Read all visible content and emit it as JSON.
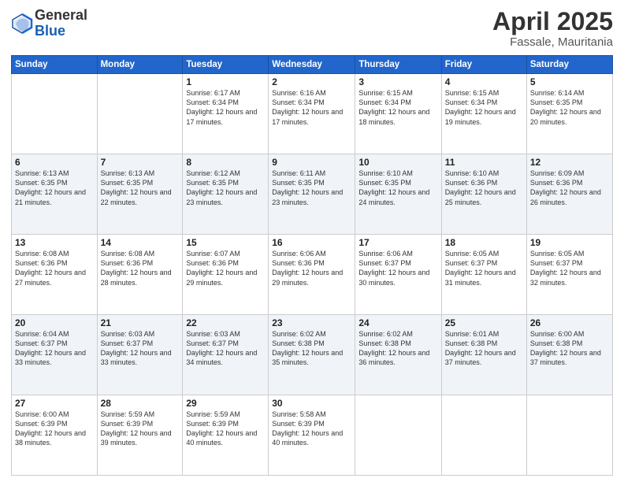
{
  "header": {
    "logo_general": "General",
    "logo_blue": "Blue",
    "month_title": "April 2025",
    "location": "Fassale, Mauritania"
  },
  "weekdays": [
    "Sunday",
    "Monday",
    "Tuesday",
    "Wednesday",
    "Thursday",
    "Friday",
    "Saturday"
  ],
  "weeks": [
    [
      {
        "day": "",
        "sunrise": "",
        "sunset": "",
        "daylight": ""
      },
      {
        "day": "",
        "sunrise": "",
        "sunset": "",
        "daylight": ""
      },
      {
        "day": "1",
        "sunrise": "Sunrise: 6:17 AM",
        "sunset": "Sunset: 6:34 PM",
        "daylight": "Daylight: 12 hours and 17 minutes."
      },
      {
        "day": "2",
        "sunrise": "Sunrise: 6:16 AM",
        "sunset": "Sunset: 6:34 PM",
        "daylight": "Daylight: 12 hours and 17 minutes."
      },
      {
        "day": "3",
        "sunrise": "Sunrise: 6:15 AM",
        "sunset": "Sunset: 6:34 PM",
        "daylight": "Daylight: 12 hours and 18 minutes."
      },
      {
        "day": "4",
        "sunrise": "Sunrise: 6:15 AM",
        "sunset": "Sunset: 6:34 PM",
        "daylight": "Daylight: 12 hours and 19 minutes."
      },
      {
        "day": "5",
        "sunrise": "Sunrise: 6:14 AM",
        "sunset": "Sunset: 6:35 PM",
        "daylight": "Daylight: 12 hours and 20 minutes."
      }
    ],
    [
      {
        "day": "6",
        "sunrise": "Sunrise: 6:13 AM",
        "sunset": "Sunset: 6:35 PM",
        "daylight": "Daylight: 12 hours and 21 minutes."
      },
      {
        "day": "7",
        "sunrise": "Sunrise: 6:13 AM",
        "sunset": "Sunset: 6:35 PM",
        "daylight": "Daylight: 12 hours and 22 minutes."
      },
      {
        "day": "8",
        "sunrise": "Sunrise: 6:12 AM",
        "sunset": "Sunset: 6:35 PM",
        "daylight": "Daylight: 12 hours and 23 minutes."
      },
      {
        "day": "9",
        "sunrise": "Sunrise: 6:11 AM",
        "sunset": "Sunset: 6:35 PM",
        "daylight": "Daylight: 12 hours and 23 minutes."
      },
      {
        "day": "10",
        "sunrise": "Sunrise: 6:10 AM",
        "sunset": "Sunset: 6:35 PM",
        "daylight": "Daylight: 12 hours and 24 minutes."
      },
      {
        "day": "11",
        "sunrise": "Sunrise: 6:10 AM",
        "sunset": "Sunset: 6:36 PM",
        "daylight": "Daylight: 12 hours and 25 minutes."
      },
      {
        "day": "12",
        "sunrise": "Sunrise: 6:09 AM",
        "sunset": "Sunset: 6:36 PM",
        "daylight": "Daylight: 12 hours and 26 minutes."
      }
    ],
    [
      {
        "day": "13",
        "sunrise": "Sunrise: 6:08 AM",
        "sunset": "Sunset: 6:36 PM",
        "daylight": "Daylight: 12 hours and 27 minutes."
      },
      {
        "day": "14",
        "sunrise": "Sunrise: 6:08 AM",
        "sunset": "Sunset: 6:36 PM",
        "daylight": "Daylight: 12 hours and 28 minutes."
      },
      {
        "day": "15",
        "sunrise": "Sunrise: 6:07 AM",
        "sunset": "Sunset: 6:36 PM",
        "daylight": "Daylight: 12 hours and 29 minutes."
      },
      {
        "day": "16",
        "sunrise": "Sunrise: 6:06 AM",
        "sunset": "Sunset: 6:36 PM",
        "daylight": "Daylight: 12 hours and 29 minutes."
      },
      {
        "day": "17",
        "sunrise": "Sunrise: 6:06 AM",
        "sunset": "Sunset: 6:37 PM",
        "daylight": "Daylight: 12 hours and 30 minutes."
      },
      {
        "day": "18",
        "sunrise": "Sunrise: 6:05 AM",
        "sunset": "Sunset: 6:37 PM",
        "daylight": "Daylight: 12 hours and 31 minutes."
      },
      {
        "day": "19",
        "sunrise": "Sunrise: 6:05 AM",
        "sunset": "Sunset: 6:37 PM",
        "daylight": "Daylight: 12 hours and 32 minutes."
      }
    ],
    [
      {
        "day": "20",
        "sunrise": "Sunrise: 6:04 AM",
        "sunset": "Sunset: 6:37 PM",
        "daylight": "Daylight: 12 hours and 33 minutes."
      },
      {
        "day": "21",
        "sunrise": "Sunrise: 6:03 AM",
        "sunset": "Sunset: 6:37 PM",
        "daylight": "Daylight: 12 hours and 33 minutes."
      },
      {
        "day": "22",
        "sunrise": "Sunrise: 6:03 AM",
        "sunset": "Sunset: 6:37 PM",
        "daylight": "Daylight: 12 hours and 34 minutes."
      },
      {
        "day": "23",
        "sunrise": "Sunrise: 6:02 AM",
        "sunset": "Sunset: 6:38 PM",
        "daylight": "Daylight: 12 hours and 35 minutes."
      },
      {
        "day": "24",
        "sunrise": "Sunrise: 6:02 AM",
        "sunset": "Sunset: 6:38 PM",
        "daylight": "Daylight: 12 hours and 36 minutes."
      },
      {
        "day": "25",
        "sunrise": "Sunrise: 6:01 AM",
        "sunset": "Sunset: 6:38 PM",
        "daylight": "Daylight: 12 hours and 37 minutes."
      },
      {
        "day": "26",
        "sunrise": "Sunrise: 6:00 AM",
        "sunset": "Sunset: 6:38 PM",
        "daylight": "Daylight: 12 hours and 37 minutes."
      }
    ],
    [
      {
        "day": "27",
        "sunrise": "Sunrise: 6:00 AM",
        "sunset": "Sunset: 6:39 PM",
        "daylight": "Daylight: 12 hours and 38 minutes."
      },
      {
        "day": "28",
        "sunrise": "Sunrise: 5:59 AM",
        "sunset": "Sunset: 6:39 PM",
        "daylight": "Daylight: 12 hours and 39 minutes."
      },
      {
        "day": "29",
        "sunrise": "Sunrise: 5:59 AM",
        "sunset": "Sunset: 6:39 PM",
        "daylight": "Daylight: 12 hours and 40 minutes."
      },
      {
        "day": "30",
        "sunrise": "Sunrise: 5:58 AM",
        "sunset": "Sunset: 6:39 PM",
        "daylight": "Daylight: 12 hours and 40 minutes."
      },
      {
        "day": "",
        "sunrise": "",
        "sunset": "",
        "daylight": ""
      },
      {
        "day": "",
        "sunrise": "",
        "sunset": "",
        "daylight": ""
      },
      {
        "day": "",
        "sunrise": "",
        "sunset": "",
        "daylight": ""
      }
    ]
  ]
}
